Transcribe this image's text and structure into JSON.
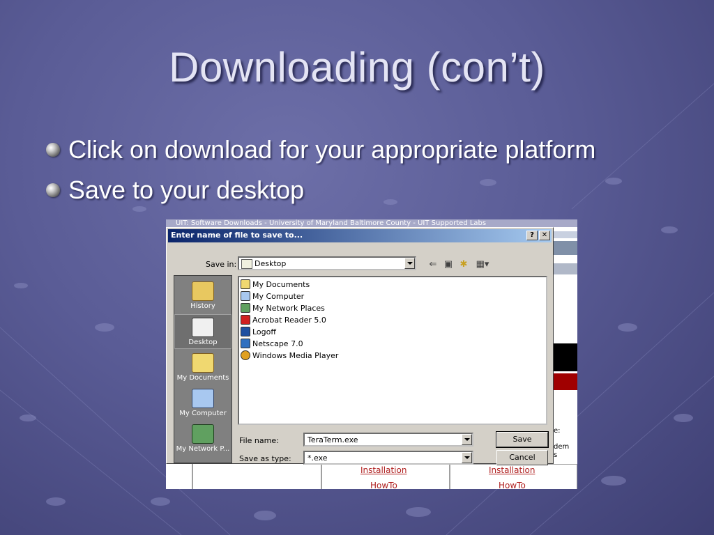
{
  "slide": {
    "title": "Downloading (con’t)",
    "bullets": [
      "Click on download for your appropriate platform",
      "Save to your desktop"
    ]
  },
  "browser": {
    "title": "UIT: Software Downloads - University of Maryland Baltimore County - UIT Supported Labs",
    "partial_text": [
      "e:",
      "dem",
      "s"
    ],
    "links": [
      "Installation",
      "Installation",
      "HowTo",
      "HowTo"
    ]
  },
  "dialog": {
    "title": "Enter name of file to save to...",
    "help_label": "?",
    "close_label": "✕",
    "save_in_label": "Save in:",
    "save_in_value": "Desktop",
    "places": [
      "History",
      "Desktop",
      "My Documents",
      "My Computer",
      "My Network P..."
    ],
    "files": [
      "My Documents",
      "My Computer",
      "My Network Places",
      "Acrobat Reader 5.0",
      "Logoff",
      "Netscape 7.0",
      "Windows Media Player"
    ],
    "file_name_label": "File name:",
    "file_name_value": "TeraTerm.exe",
    "save_as_type_label": "Save as type:",
    "save_as_type_value": "*.exe",
    "save_button": "Save",
    "cancel_button": "Cancel"
  },
  "colors": {
    "background": "#5a5c96",
    "titlebar": "#0a246a",
    "link": "#b02020"
  }
}
